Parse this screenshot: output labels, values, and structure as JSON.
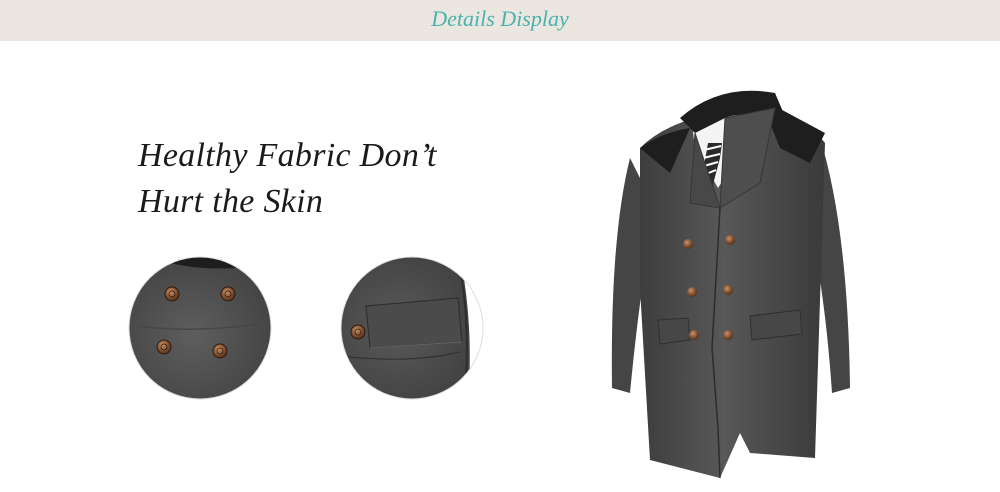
{
  "banner": {
    "title": "Details Display",
    "background": "#ebe6df",
    "title_color": "#4ab3ad"
  },
  "headline": {
    "line1": "Healthy Fabric Don’t",
    "line2": "Hurt the Skin"
  },
  "images": {
    "detail_buttons": "coat-buttons-closeup",
    "detail_pocket": "coat-pocket-flap-closeup",
    "product": "gray-double-breasted-wool-coat"
  },
  "colors": {
    "fabric": "#4f4f4f",
    "collar": "#1e1e1e",
    "button": "#8a5a3a"
  }
}
